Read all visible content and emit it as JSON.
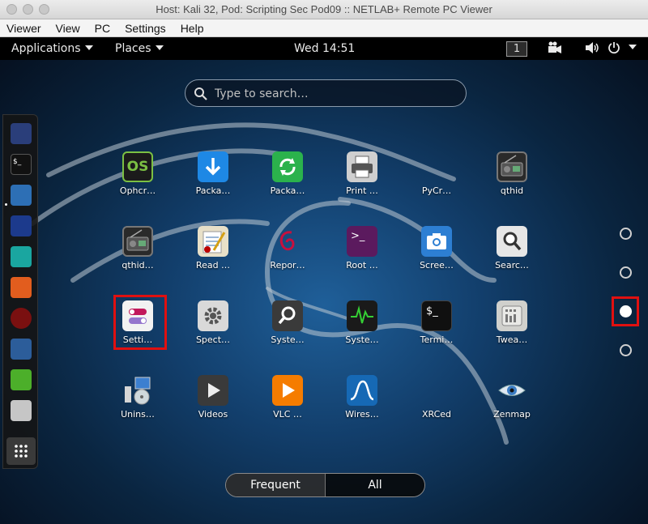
{
  "window": {
    "title": "Host: Kali 32, Pod: Scripting Sec Pod09 :: NETLAB+ Remote PC Viewer"
  },
  "menubar": [
    "Viewer",
    "View",
    "PC",
    "Settings",
    "Help"
  ],
  "topbar": {
    "applications": "Applications",
    "places": "Places",
    "clock": "Wed 14:51",
    "workspace": "1"
  },
  "search": {
    "placeholder": "Type to search…"
  },
  "dash": [
    "maltego-icon",
    "terminal-icon",
    "files-icon",
    "metasploit-icon",
    "armitage-icon",
    "burpsuite-icon",
    "faraday-icon",
    "beef-icon",
    "leafpad-icon",
    "radio-icon",
    "show-apps-icon"
  ],
  "apps": [
    {
      "label": "Ophcr…",
      "icon": "ophcrack-icon",
      "color": "#1b1b1b"
    },
    {
      "label": "Packa…",
      "icon": "package-download-icon",
      "color": "#1e88e5"
    },
    {
      "label": "Packa…",
      "icon": "package-update-icon",
      "color": "#2bb24c"
    },
    {
      "label": "Print …",
      "icon": "printer-icon",
      "color": "#cfcfcf"
    },
    {
      "label": "PyCr…",
      "icon": "pycrust-icon",
      "color": ""
    },
    {
      "label": "qthid",
      "icon": "radio-icon",
      "color": "#2a2a2a"
    },
    {
      "label": "qthid…",
      "icon": "radio-icon",
      "color": "#2a2a2a"
    },
    {
      "label": "Read …",
      "icon": "notepad-icon",
      "color": "#e8e0c8"
    },
    {
      "label": "Repor…",
      "icon": "debian-swirl-icon",
      "color": ""
    },
    {
      "label": "Root …",
      "icon": "root-terminal-icon",
      "color": "#5b1a5e"
    },
    {
      "label": "Scree…",
      "icon": "camera-icon",
      "color": "#2d7fd3"
    },
    {
      "label": "Searc…",
      "icon": "search-icon",
      "color": "#e6e6e6"
    },
    {
      "label": "Setti…",
      "icon": "settings-toggle-icon",
      "color": "#f2f2f2"
    },
    {
      "label": "Spect…",
      "icon": "gear-icon",
      "color": "#d9d9d9"
    },
    {
      "label": "Syste…",
      "icon": "magnifier-icon",
      "color": "#3a3a3a"
    },
    {
      "label": "Syste…",
      "icon": "system-monitor-icon",
      "color": "#1a1a1a"
    },
    {
      "label": "Termi…",
      "icon": "terminal-icon",
      "color": "#101010"
    },
    {
      "label": "Twea…",
      "icon": "tweaks-icon",
      "color": "#d0d0cc"
    },
    {
      "label": "Unins…",
      "icon": "uninstall-icon",
      "color": ""
    },
    {
      "label": "Videos",
      "icon": "video-play-icon",
      "color": "#3a3a3a"
    },
    {
      "label": "VLC …",
      "icon": "vlc-play-icon",
      "color": "#f57c00"
    },
    {
      "label": "Wires…",
      "icon": "wireshark-icon",
      "color": "#1669b5"
    },
    {
      "label": "XRCed",
      "icon": "xrced-icon",
      "color": ""
    },
    {
      "label": "Zenmap",
      "icon": "eye-icon",
      "color": ""
    }
  ],
  "tabs": {
    "frequent": "Frequent",
    "all": "All"
  },
  "highlight_color": "#e01010"
}
